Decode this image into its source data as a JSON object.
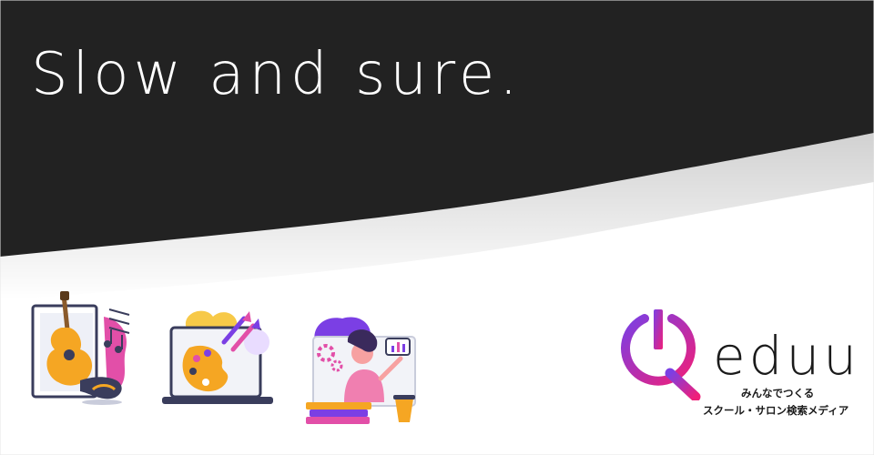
{
  "banner": {
    "headline": "Slow and sure.",
    "colors": {
      "dark_band": "#222222",
      "background": "#ffffff"
    }
  },
  "illustrations": [
    {
      "name": "guitar-music-icon"
    },
    {
      "name": "art-palette-icon"
    },
    {
      "name": "online-lesson-icon"
    }
  ],
  "brand": {
    "name": "eduu",
    "tagline_1": "みんなでつくる",
    "tagline_2": "スクール・サロン検索メディア",
    "colors": {
      "gradient_start": "#7b3fe4",
      "gradient_end": "#ef1f7a"
    }
  }
}
